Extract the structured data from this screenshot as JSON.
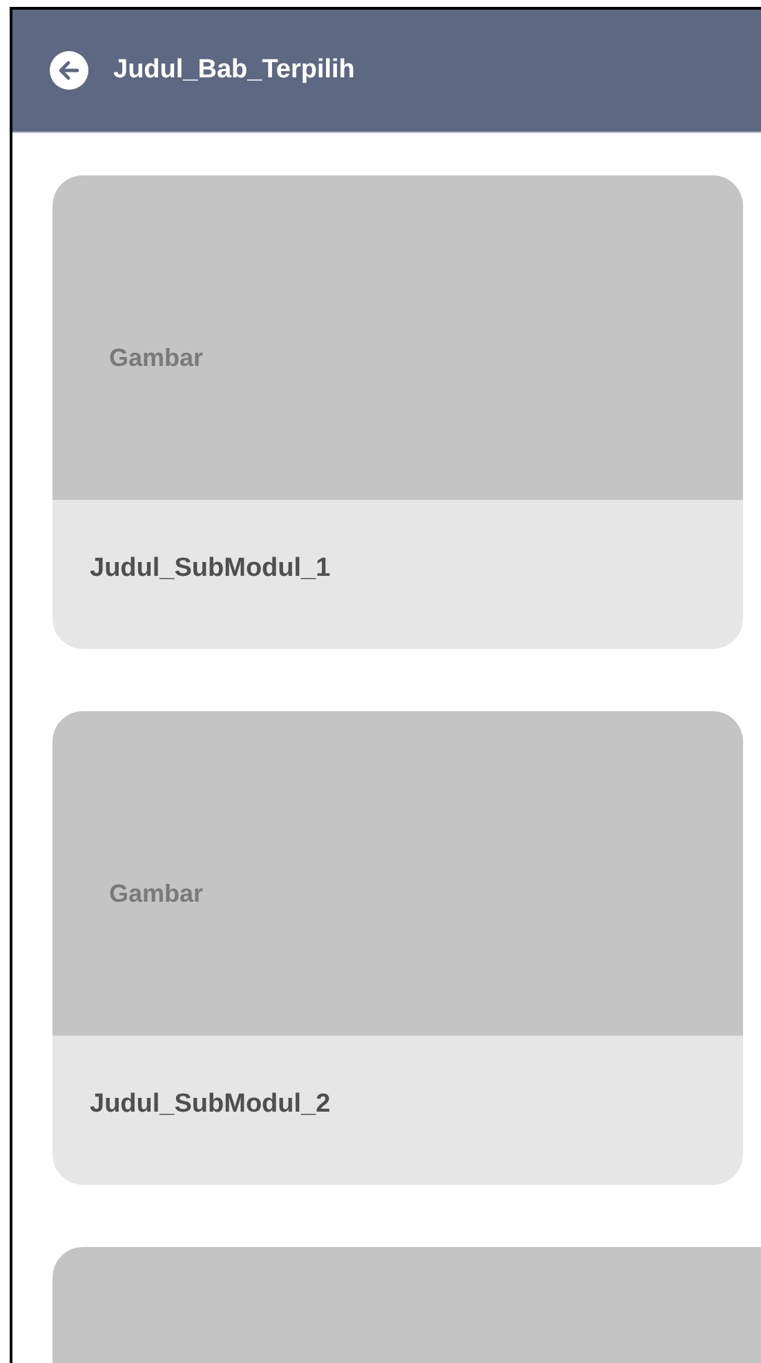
{
  "header": {
    "title": "Judul_Bab_Terpilih"
  },
  "cards": [
    {
      "kind": "card",
      "image_label": "Gambar",
      "title": "Judul_SubModul_1"
    },
    {
      "kind": "card",
      "image_label": "Gambar",
      "title": "Judul_SubModul_2"
    },
    {
      "kind": "image_only"
    }
  ]
}
